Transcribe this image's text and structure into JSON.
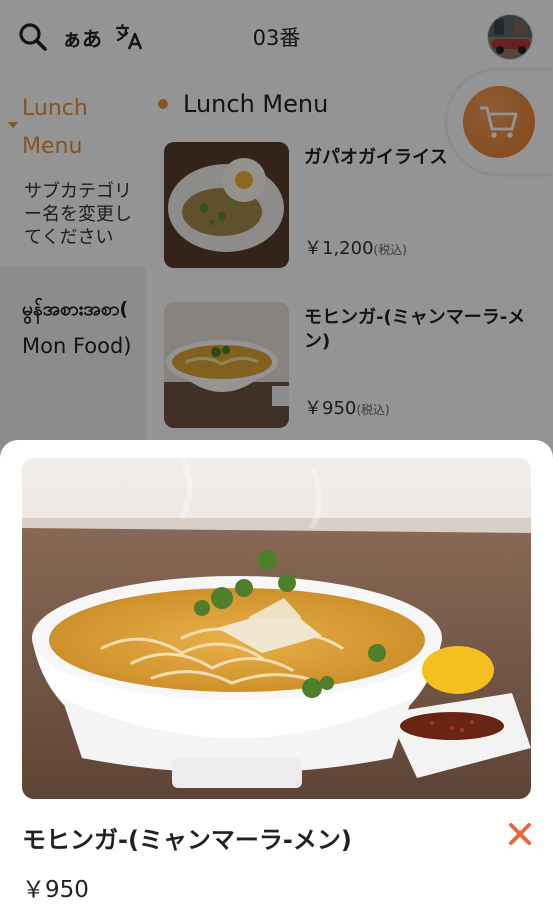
{
  "header": {
    "kana_toggle": "ぁあ",
    "table_number": "03番",
    "icons": [
      "search-icon",
      "translate-icon",
      "avatar",
      "cart-icon",
      "close-icon"
    ]
  },
  "sidebar": {
    "active_category": "Lunch Menu",
    "active_sub": "サブカテゴリー名を変更してください",
    "other_category_my": "မွန်အစားအစာ(",
    "other_category_en": "Mon Food)"
  },
  "main": {
    "section_title": "Lunch Menu",
    "items": [
      {
        "name": "ガパオガイライス",
        "price": "￥1,200",
        "tax": "(税込)"
      },
      {
        "name": "モヒンガ-(ミャンマーラ-メン)",
        "price": "￥950",
        "tax": "(税込)"
      }
    ]
  },
  "detail": {
    "name": "モヒンガ-(ミャンマーラ-メン)",
    "price": "￥950"
  },
  "colors": {
    "accent": "#e8913a",
    "close": "#e8663a"
  }
}
